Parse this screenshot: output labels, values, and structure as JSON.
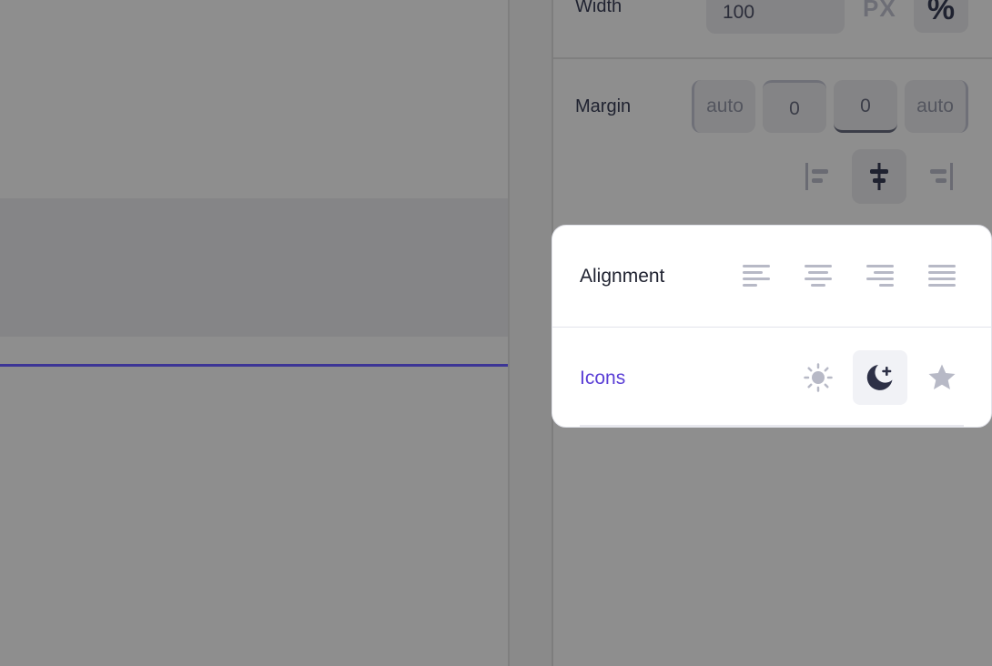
{
  "inspector": {
    "width": {
      "label": "Width",
      "value": "100",
      "unit_px": "PX",
      "unit_pct": "%"
    },
    "margin": {
      "label": "Margin",
      "left": "auto",
      "top": "0",
      "bottom": "0",
      "right": "auto"
    },
    "block_alignment": {
      "options": [
        "align-left-icon",
        "align-center-icon",
        "align-right-icon"
      ],
      "selected": "align-center-icon"
    }
  },
  "popup": {
    "alignment": {
      "label": "Alignment",
      "options": [
        "text-align-left-icon",
        "text-align-center-icon",
        "text-align-right-icon",
        "text-align-justify-icon"
      ]
    },
    "icons": {
      "label": "Icons",
      "options": [
        "sun-icon",
        "moon-plus-icon",
        "star-icon"
      ],
      "selected": "moon-plus-icon"
    }
  },
  "colors": {
    "accent": "#5b3fd6",
    "canvas_line": "#3c3596",
    "icon_muted": "#b7b9c6",
    "icon_active": "#2d3046"
  }
}
